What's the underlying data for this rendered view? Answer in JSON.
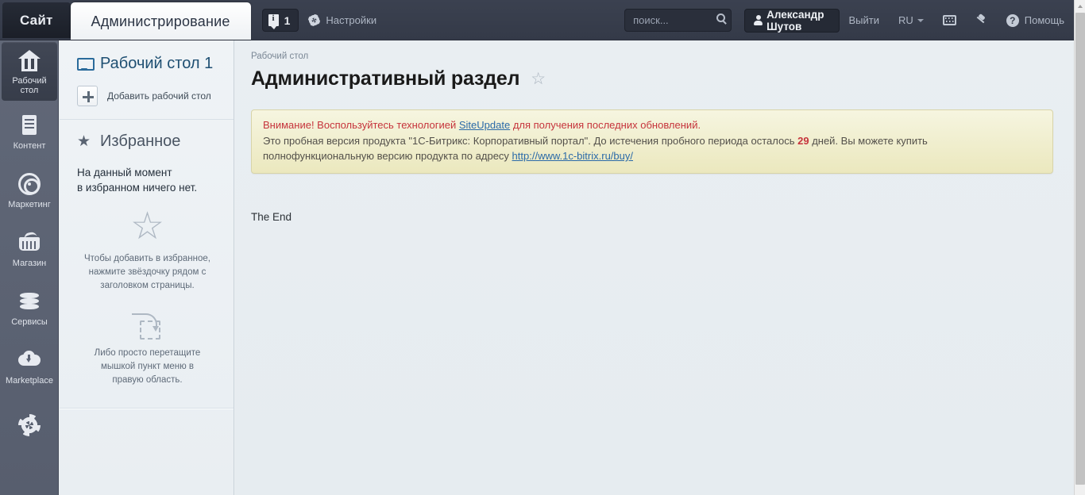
{
  "topbar": {
    "tabs": [
      {
        "label": "Сайт",
        "active": false
      },
      {
        "label": "Администрирование",
        "active": true
      }
    ],
    "notification_count": "1",
    "settings_label": "Настройки",
    "search": {
      "placeholder": "поиск...",
      "value": ""
    },
    "user_name": "Александр Шутов",
    "logout_label": "Выйти",
    "language": "RU",
    "help_label": "Помощь",
    "help_glyph": "?"
  },
  "rail": {
    "items": [
      {
        "label": "Рабочий\nстол",
        "icon": "home-icon",
        "active": true
      },
      {
        "label": "Контент",
        "icon": "document-icon",
        "active": false
      },
      {
        "label": "Маркетинг",
        "icon": "target-icon",
        "active": false
      },
      {
        "label": "Магазин",
        "icon": "basket-icon",
        "active": false
      },
      {
        "label": "Сервисы",
        "icon": "layers-icon",
        "active": false
      },
      {
        "label": "Marketplace",
        "icon": "cloud-download-icon",
        "active": false
      },
      {
        "label": "",
        "icon": "gear-icon",
        "active": false
      }
    ],
    "line1": "Рабочий",
    "line2": "стол"
  },
  "panel": {
    "desktop_title": "Рабочий стол 1",
    "add_desktop_label": "Добавить рабочий стол",
    "favorites_title": "Избранное",
    "favorites_star": "★",
    "empty_line1": "На данный момент",
    "empty_line2": "в избранном ничего нет.",
    "big_star": "☆",
    "hint1": "Чтобы добавить в избранное,\nнажмите звёздочку рядом с\nзаголовком страницы.",
    "hint1_l1": "Чтобы добавить в избранное,",
    "hint1_l2": "нажмите звёздочку рядом с",
    "hint1_l3": "заголовком страницы.",
    "hint2_l1": "Либо просто перетащите",
    "hint2_l2": "мышкой пункт меню в",
    "hint2_l3": "правую область."
  },
  "main": {
    "breadcrumb": "Рабочий стол",
    "page_title": "Административный раздел",
    "favorite_star": "☆",
    "notice": {
      "line1_pre": "Внимание! Воспользуйтесь технологией ",
      "line1_link": "SiteUpdate",
      "line1_post": " для получения последних обновлений.",
      "line2_pre": "Это пробная версия продукта \"1С-Битрикс: Корпоративный портал\". До истечения пробного периода осталось ",
      "line2_days": "29",
      "line2_post": " дней. Вы можете купить",
      "line3_pre": "полнофункциональную версию продукта по адресу ",
      "line3_link": "http://www.1c-bitrix.ru/buy/"
    },
    "body_text": "The End"
  },
  "colors": {
    "topbar_bg": "#373d4b",
    "rail_bg": "#5d6475",
    "panel_bg": "#eef2f5",
    "content_bg": "#e7edf1",
    "notice_bg": "#f1efd4",
    "notice_border": "#d8d4a8",
    "alert_red": "#c6343c",
    "link_blue": "#2b6aa8",
    "title_blue": "#1e4f72"
  }
}
